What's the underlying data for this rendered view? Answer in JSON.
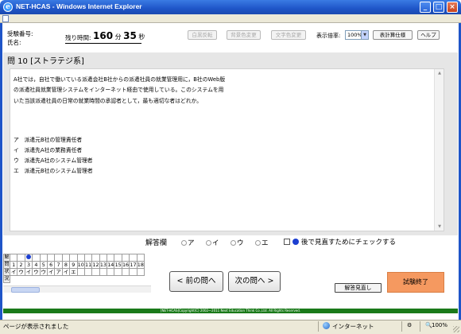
{
  "window": {
    "title": "NET-HCAS - Windows Internet Explorer"
  },
  "header": {
    "exam_number_label": "受験番号:",
    "name_label": "氏名:",
    "time_label": "残り時間:",
    "time_minutes": "160",
    "minutes_unit": "分",
    "time_seconds": "35",
    "seconds_unit": "秒",
    "buttons": {
      "invert": "白黒反転",
      "bg_color": "背景色変更",
      "text_color": "文字色変更",
      "display_scale_label": "表示倍率:",
      "display_scale_value": "100%",
      "spec": "表計算仕様",
      "help": "ヘルプ"
    }
  },
  "question": {
    "title": "問 10 [ストラテジ系]",
    "text": "A社では，自社で働いている派遣会社B社からの派遣社員の就業管理用に，B社のWeb版の派遣社員就業管理システムをインターネット経由で使用している。このシステムを用いた当該派遣社員の日常の就業時間の承認者として，最も適切な者はどれか。",
    "choices": [
      "ア　派遣元B社の管理責任者",
      "イ　派遣先A社の業務責任者",
      "ウ　派遣先A社のシステム管理者",
      "エ　派遣元B社のシステム管理者"
    ]
  },
  "answer": {
    "label": "解答欄",
    "options": [
      "ア",
      "イ",
      "ウ",
      "エ"
    ],
    "review_label": "後で見直すためにチェックする"
  },
  "grid": {
    "row_labels": [
      "解",
      "問",
      "状"
    ],
    "extra_row_label": "況",
    "numbers": [
      "1",
      "2",
      "3",
      "4",
      "5",
      "6",
      "7",
      "8",
      "9",
      "10",
      "11",
      "12",
      "13",
      "14",
      "15",
      "16",
      "17",
      "18"
    ],
    "answers": [
      "イ",
      "ウ",
      "イ",
      "ウ",
      "ウ",
      "イ",
      "ア",
      "イ",
      "エ",
      "",
      "",
      "",
      "",
      "",
      "",
      "",
      "",
      ""
    ],
    "marked_index": 3
  },
  "navigation": {
    "prev": "< 前の問へ",
    "next": "次の問へ >",
    "answer_list": "解答見直し",
    "end_exam": "試験終了"
  },
  "footer": {
    "copyright": "[NET-HCAS]Copyright(C) 2002～2011 Next Education Think Co.,Ltd. All Rights Reserved."
  },
  "statusbar": {
    "status": "ページが表示されました",
    "zone": "インターネット",
    "zoom": "100%"
  },
  "colors": {
    "titlebar": "#1f55c8",
    "panel": "#e6e6e6",
    "footer": "#1a7a1a",
    "end_button": "#f59960",
    "mark": "#1c3fd1"
  }
}
